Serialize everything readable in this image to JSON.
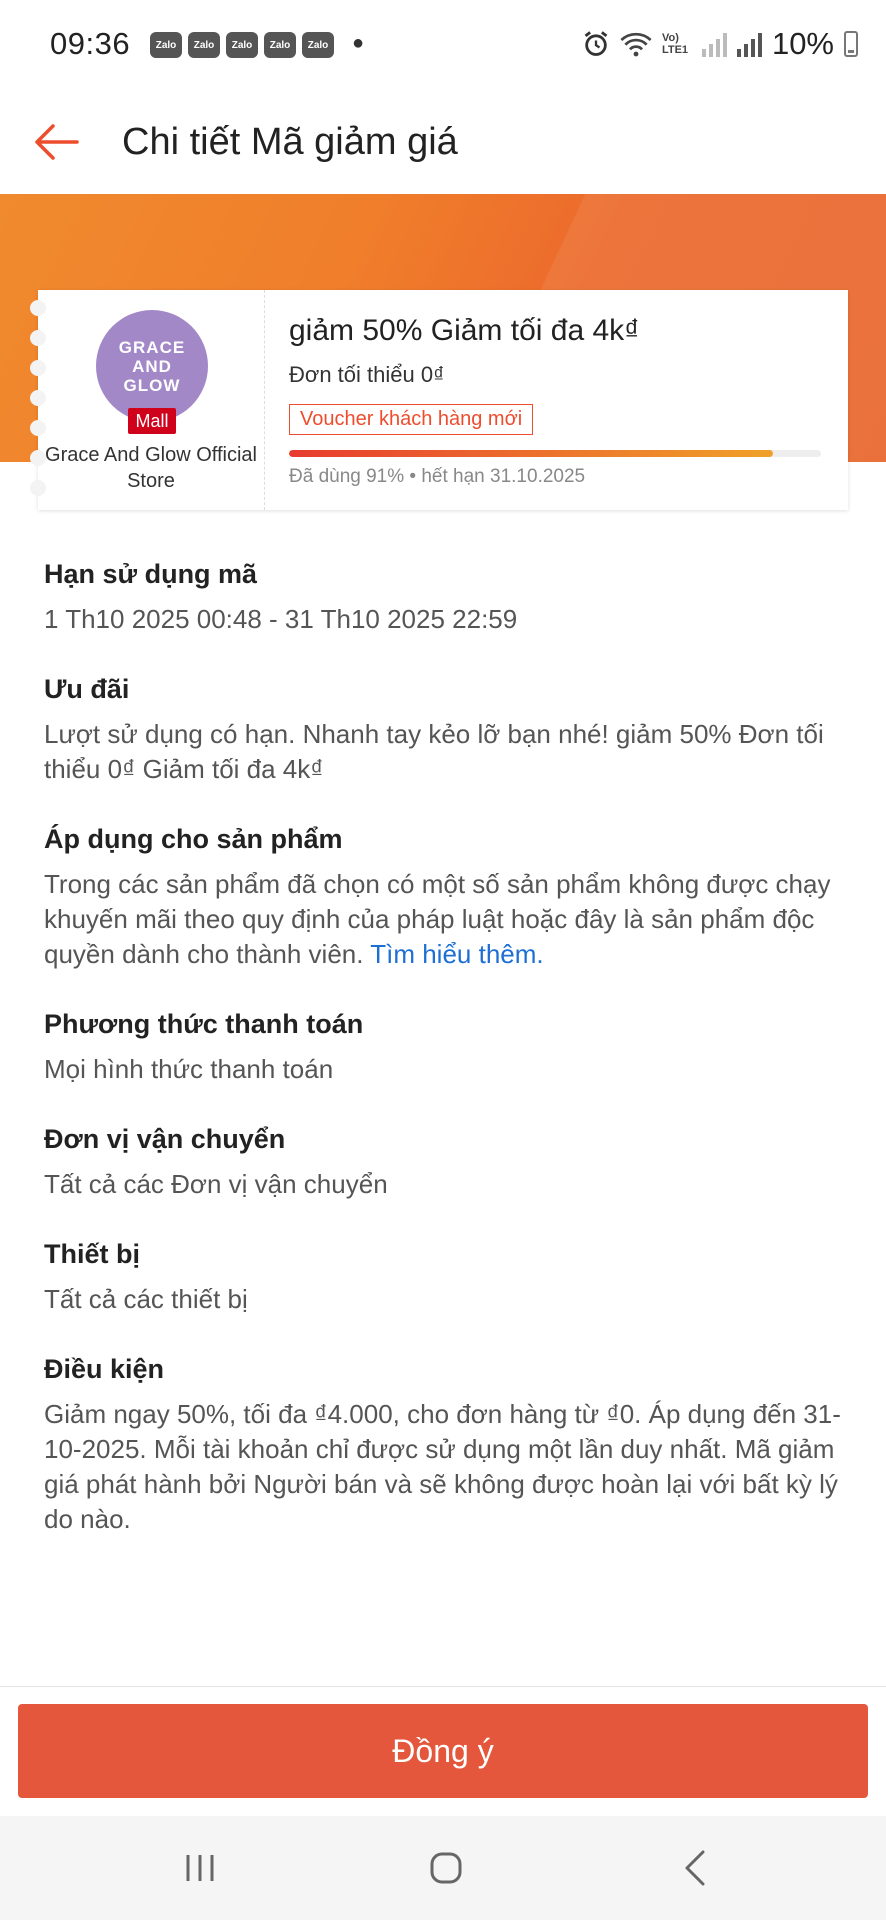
{
  "status_bar": {
    "time": "09:36",
    "notification_label": "Zalo",
    "notification_count": 5,
    "network_label": "Vo) LTE1",
    "battery": "10%"
  },
  "header": {
    "title": "Chi tiết Mã giảm giá"
  },
  "voucher": {
    "store_logo_lines": [
      "GRACE",
      "AND",
      "GLOW"
    ],
    "mall_badge": "Mall",
    "store_name": "Grace And Glow Official Store",
    "title": "giảm 50% Giảm tối đa 4k₫",
    "min_order": "Đơn tối thiểu 0₫",
    "tag": "Voucher khách hàng mới",
    "used_fraction": 0.91,
    "usage_text": "Đã dùng 91% • hết hạn 31.10.2025"
  },
  "sections": {
    "validity": {
      "title": "Hạn sử dụng mã",
      "body": "1 Th10 2025 00:48 - 31 Th10 2025 22:59"
    },
    "offer": {
      "title": "Ưu đãi",
      "body": "Lượt sử dụng có hạn. Nhanh tay kẻo lỡ bạn nhé! giảm 50% Đơn tối thiểu 0₫ Giảm tối đa 4k₫"
    },
    "products": {
      "title": "Áp dụng cho sản phẩm",
      "body": "Trong các sản phẩm đã chọn có một số sản phẩm không được chạy khuyến mãi theo quy định của pháp luật hoặc đây là sản phẩm độc quyền dành cho thành viên. ",
      "link": "Tìm hiểu thêm."
    },
    "payment": {
      "title": "Phương thức thanh toán",
      "body": "Mọi hình thức thanh toán"
    },
    "shipping": {
      "title": "Đơn vị vận chuyển",
      "body": "Tất cả các Đơn vị vận chuyển"
    },
    "device": {
      "title": "Thiết bị",
      "body": "Tất cả các thiết bị"
    },
    "conditions": {
      "title": "Điều kiện",
      "body": "Giảm ngay 50%, tối đa ₫4.000, cho đơn hàng từ ₫0. Áp dụng đến 31-10-2025. Mỗi tài khoản chỉ được sử dụng một lần duy nhất. Mã giảm giá phát hành bởi Người bán và sẽ không được hoàn lại với bất kỳ lý do nào."
    }
  },
  "footer": {
    "agree_label": "Đồng ý"
  },
  "colors": {
    "brand": "#ee4d2d",
    "button": "#e4573c",
    "link": "#1e6fd4"
  },
  "icons": [
    "back-arrow-icon",
    "alarm-icon",
    "wifi-icon",
    "signal-icon",
    "battery-icon",
    "recent-apps-icon",
    "home-icon",
    "back-icon"
  ]
}
